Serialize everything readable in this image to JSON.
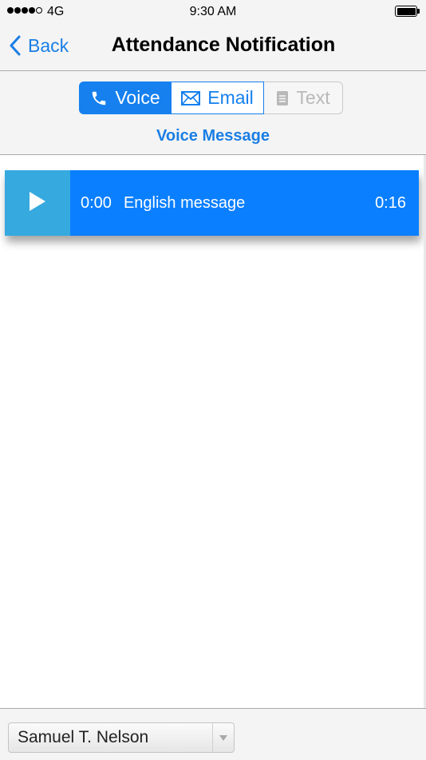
{
  "status_bar": {
    "network": "4G",
    "time": "9:30 AM",
    "signal_bars_filled": 4,
    "signal_bars_total": 5
  },
  "nav": {
    "back_label": "Back",
    "title": "Attendance Notification"
  },
  "tabs": {
    "voice": "Voice",
    "email": "Email",
    "text": "Text",
    "selected": "voice"
  },
  "section_title": "Voice Message",
  "message": {
    "elapsed": "0:00",
    "label": "English message",
    "duration": "0:16"
  },
  "student_select": {
    "value": "Samuel T. Nelson"
  },
  "colors": {
    "accent": "#1580ee",
    "play_button": "#36a9de",
    "message_bar": "#0a7fff",
    "disabled_text": "#b9b9b9"
  },
  "icons": {
    "back": "chevron-left-icon",
    "voice": "phone-icon",
    "email": "envelope-icon",
    "text": "document-icon",
    "play": "play-icon",
    "select": "triangle-down-icon"
  }
}
